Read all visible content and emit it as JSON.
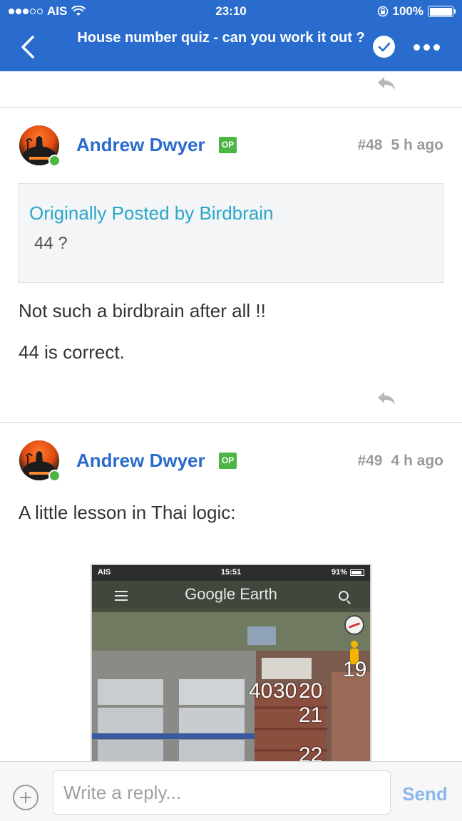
{
  "status_bar": {
    "carrier": "AIS",
    "time": "23:10",
    "battery": "100%",
    "battery_level": 1.0
  },
  "nav": {
    "title": "House number quiz - can you work it out ?"
  },
  "posts": [
    {
      "author": "Andrew Dwyer",
      "badge": "OP",
      "number": "#48",
      "time_ago": "5 h ago",
      "quote": {
        "author": "Originally Posted by Birdbrain",
        "text": "44 ?"
      },
      "paragraphs": [
        "Not such a birdbrain after all !!",
        "44 is correct."
      ]
    },
    {
      "author": "Andrew Dwyer",
      "badge": "OP",
      "number": "#49",
      "time_ago": "4 h ago",
      "paragraphs": [
        "A little lesson in Thai logic:"
      ],
      "embedded_screenshot": {
        "carrier": "AIS",
        "time": "15:51",
        "battery": "91%",
        "app_title": "Google Earth",
        "labels": [
          "19",
          "40",
          "30",
          "20",
          "21",
          "22"
        ]
      }
    }
  ],
  "composer": {
    "placeholder": "Write a reply...",
    "send_label": "Send"
  },
  "colors": {
    "brand_blue": "#2a6ccd",
    "quote_author": "#2aa7c9",
    "online_green": "#4cb543",
    "send_disabled": "#8ab8ec"
  }
}
